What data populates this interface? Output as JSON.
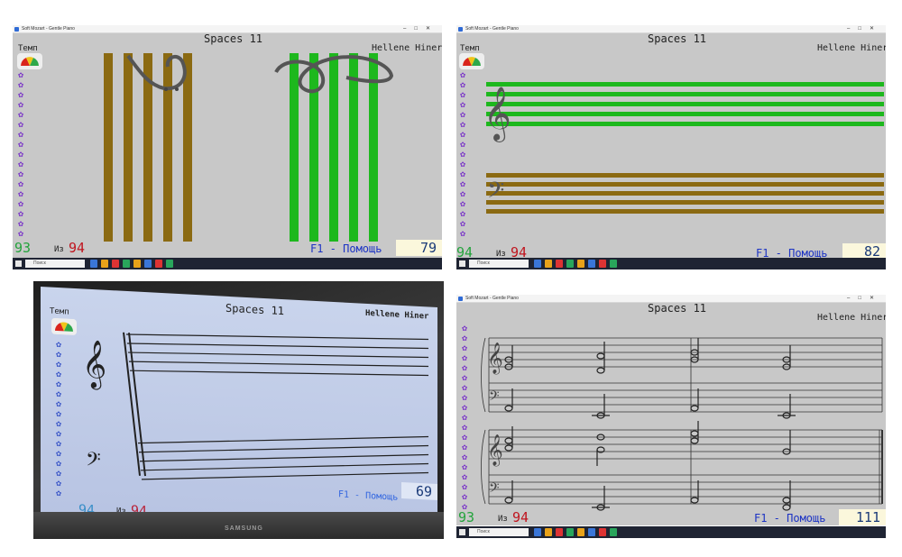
{
  "colors": {
    "panel_bg": "#c8c8c8",
    "staff_green": "#1db81d",
    "staff_brown": "#8b6a12",
    "flower": "#7a35c8",
    "count_green": "#23a33c",
    "total_red": "#c0141e",
    "help_blue": "#1c33c4",
    "taskbar": "#1f2433"
  },
  "common": {
    "window_title": "Soft Mozart - Gentle Piano",
    "song_title": "Spaces 11",
    "author": "Hellene Hiner",
    "tempo_label": "Темп",
    "of_label": "Из",
    "help": "F1 - Помощь",
    "search_placeholder": "Поиск",
    "brand": "SAMSUNG"
  },
  "panels": [
    {
      "id": "vertical-staves",
      "count": "93",
      "total": "94",
      "score": "79"
    },
    {
      "id": "horizontal-staves",
      "count": "94",
      "total": "94",
      "score": "82"
    },
    {
      "id": "laptop-photo",
      "count": "94",
      "total": "94",
      "score": "69"
    },
    {
      "id": "grand-staff-notation",
      "count": "93",
      "total": "94",
      "score": "111"
    }
  ]
}
